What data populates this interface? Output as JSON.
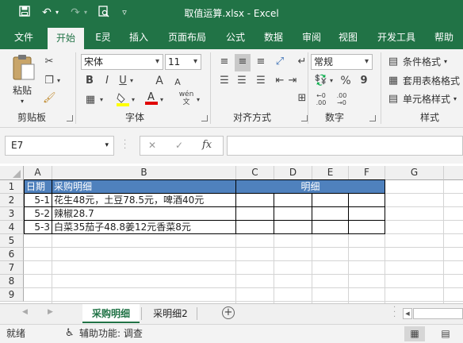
{
  "title": "取值运算.xlsx  -  Excel",
  "qat": {
    "save": "save-icon",
    "undo": "undo-icon",
    "redo": "redo-icon",
    "preview": "print-preview-icon",
    "customize": "▿"
  },
  "tabs": [
    "文件",
    "开始",
    "E灵",
    "插入",
    "页面布局",
    "公式",
    "数据",
    "审阅",
    "视图",
    "开发工具",
    "帮助"
  ],
  "active_tab": "开始",
  "ribbon": {
    "clipboard": {
      "paste": "粘贴",
      "label": "剪贴板"
    },
    "font": {
      "name": "宋体",
      "size": "11",
      "bold": "B",
      "italic": "I",
      "underline": "U",
      "grow": "A",
      "shrink": "A",
      "wen": "wén",
      "label": "字体"
    },
    "alignment": {
      "label": "对齐方式"
    },
    "number": {
      "format": "常规",
      "percent": "%",
      "comma": "9",
      "label": "数字"
    },
    "styles": {
      "conditional": "条件格式",
      "table": "套用表格格式",
      "cell": "单元格样式",
      "label": "样式"
    }
  },
  "formula_bar": {
    "name_box": "E7",
    "cancel": "✕",
    "enter": "✓",
    "fx": "fx",
    "formula": ""
  },
  "columns": [
    "A",
    "B",
    "C",
    "D",
    "E",
    "F",
    "G"
  ],
  "rows": [
    "1",
    "2",
    "3",
    "4",
    "5",
    "6",
    "7",
    "8",
    "9"
  ],
  "cells": {
    "A1": "日期",
    "B1": "采购明细",
    "merged_C1_F1": "明细",
    "A2": "5-1",
    "B2": "花生48元，土豆78.5元，啤酒40元",
    "A3": "5-2",
    "B3": "辣椒28.7",
    "A4": "5-3",
    "B4": "白菜35茄子48.8姜12元香菜8元"
  },
  "header_fill": "#4f81bd",
  "sheets": [
    "采购明细",
    "采明细2"
  ],
  "active_sheet": "采购明细",
  "status": {
    "ready": "就绪",
    "accessibility": "辅助功能: 调查"
  },
  "colors": {
    "excel_green": "#217346"
  }
}
